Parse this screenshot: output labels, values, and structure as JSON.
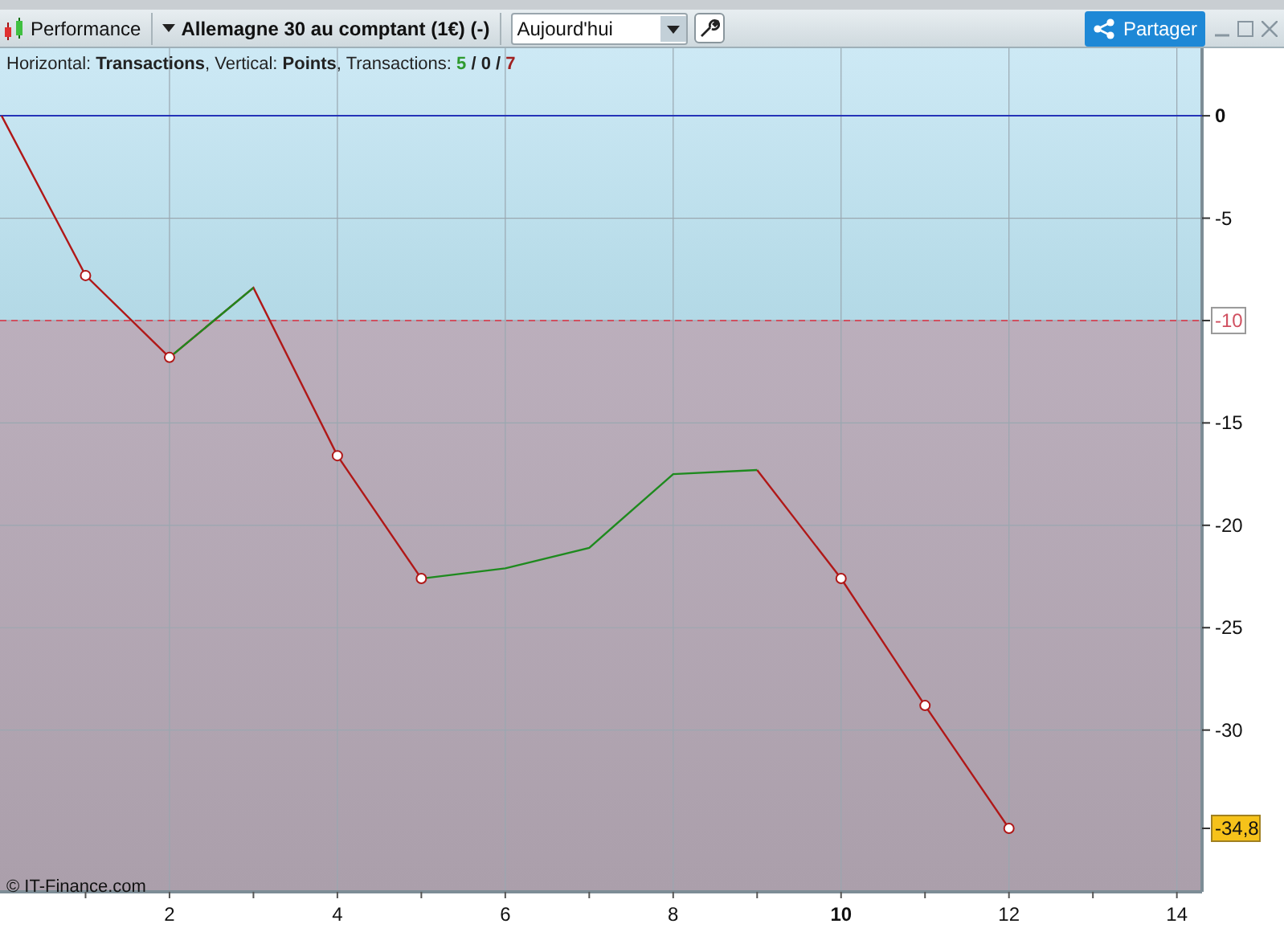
{
  "toolbar": {
    "indicator": "Performance",
    "instrument": "Allemagne 30 au comptant (1€) (-)",
    "period": "Aujourd'hui",
    "share_button": "Partager"
  },
  "info": {
    "text": "Horizontal: **Transactions**, Vertical: **Points**, Transactions:",
    "separator": "/",
    "counts": [
      {
        "value": "5",
        "color": "#2e9a2e"
      },
      {
        "value": "0",
        "color": "#222222"
      },
      {
        "value": "7",
        "color": "#a02020"
      }
    ]
  },
  "chart": {
    "copyright": "© IT-Finance.com",
    "bold_xticks": [
      false,
      false,
      false,
      false,
      true,
      false,
      false
    ],
    "bold_yticks": [
      true,
      false,
      false,
      false,
      false,
      false,
      false
    ],
    "chart_data": {
      "type": "line",
      "x": [
        0,
        1,
        2,
        3,
        4,
        5,
        6,
        7,
        8,
        9,
        10,
        11,
        12
      ],
      "series": [
        {
          "color": "#b01818",
          "marker": "o",
          "values": [
            0,
            -7.8,
            -11.8,
            -8.4,
            -16.6,
            -22.6,
            null,
            null,
            null,
            -17.3,
            -22.6,
            -28.8,
            -34.8
          ]
        },
        {
          "color": "#1e8a1e",
          "values": [
            null,
            null,
            -11.8,
            -8.4,
            null,
            -22.6,
            -22.1,
            -21.1,
            -17.5,
            -17.3,
            null,
            null,
            null
          ]
        }
      ],
      "xlim": [
        0,
        14.3
      ],
      "ylim": [
        -37.9,
        3.3
      ],
      "grid": true,
      "xticks": [
        2,
        4,
        6,
        8,
        10,
        12,
        14
      ],
      "yticks": [
        {
          "value": 0,
          "label": "0"
        },
        {
          "value": -5,
          "label": "-5"
        },
        {
          "value": -10,
          "label": "-10"
        },
        {
          "value": -15,
          "label": "-15"
        },
        {
          "value": -20,
          "label": "-20"
        },
        {
          "value": -25,
          "label": "-25"
        },
        {
          "value": -30,
          "label": "-30"
        }
      ],
      "ref_lines": [
        {
          "axis": "y",
          "value": 0,
          "color": "#2533b8"
        },
        {
          "axis": "y",
          "value": -10,
          "color": "#d05060"
        }
      ],
      "annotations": [
        "-34,8"
      ]
    }
  }
}
